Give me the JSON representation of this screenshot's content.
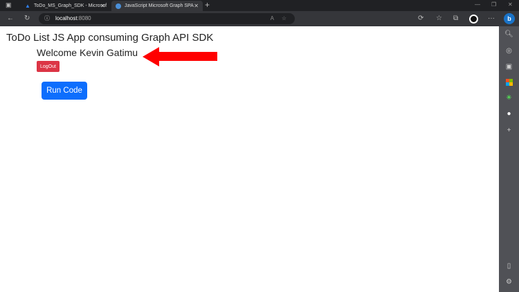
{
  "browser": {
    "tabs": [
      {
        "title": "ToDo_MS_Graph_SDK - Microsof"
      },
      {
        "title": "JavaScript Microsoft Graph SPA"
      }
    ],
    "url_host": "localhost",
    "url_port": ":8080"
  },
  "page": {
    "title": "ToDo List JS App consuming Graph API SDK",
    "welcome": "Welcome Kevin Gatimu",
    "logout_label": "LogOut",
    "run_label": "Run Code"
  },
  "colors": {
    "logout": "#dc3545",
    "run": "#0d6efd",
    "arrow": "#ff0000"
  }
}
